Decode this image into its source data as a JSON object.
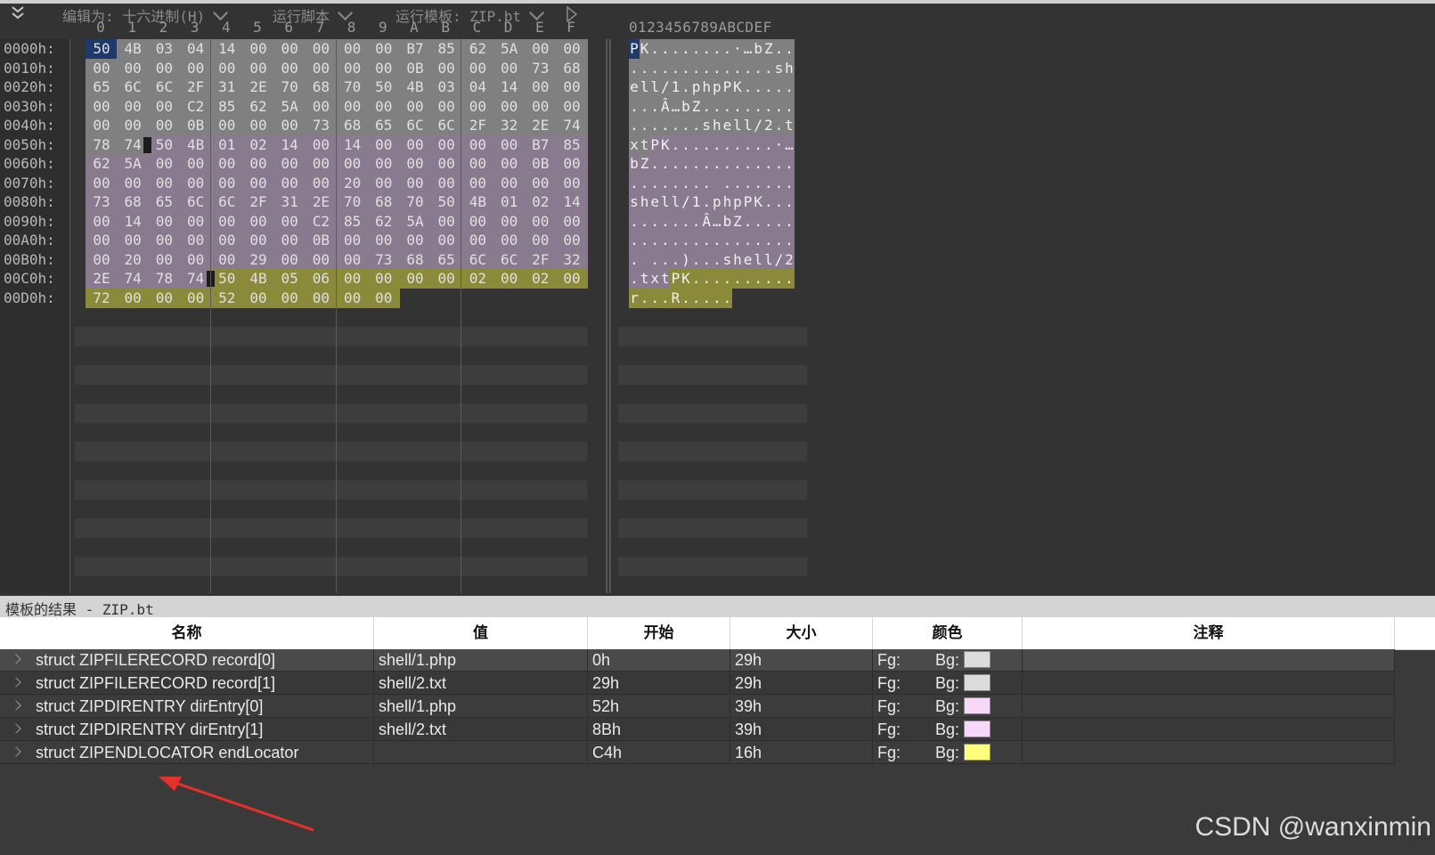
{
  "toolbar": {
    "edit_as": "编辑为: 十六进制(H)",
    "run_script": "运行脚本",
    "run_template": "运行模板: ZIP.bt"
  },
  "hex_view": {
    "column_headers": [
      "0",
      "1",
      "2",
      "3",
      "4",
      "5",
      "6",
      "7",
      "8",
      "9",
      "A",
      "B",
      "C",
      "D",
      "E",
      "F"
    ],
    "ascii_header": "0123456789ABCDEF",
    "rows": [
      {
        "offset": "0000h:",
        "bytes": [
          "50",
          "4B",
          "03",
          "04",
          "14",
          "00",
          "00",
          "00",
          "00",
          "00",
          "B7",
          "85",
          "62",
          "5A",
          "00",
          "00"
        ],
        "ascii": "PK........·…bZ.."
      },
      {
        "offset": "0010h:",
        "bytes": [
          "00",
          "00",
          "00",
          "00",
          "00",
          "00",
          "00",
          "00",
          "00",
          "00",
          "0B",
          "00",
          "00",
          "00",
          "73",
          "68"
        ],
        "ascii": "..............sh"
      },
      {
        "offset": "0020h:",
        "bytes": [
          "65",
          "6C",
          "6C",
          "2F",
          "31",
          "2E",
          "70",
          "68",
          "70",
          "50",
          "4B",
          "03",
          "04",
          "14",
          "00",
          "00"
        ],
        "ascii": "ell/1.phpPK....."
      },
      {
        "offset": "0030h:",
        "bytes": [
          "00",
          "00",
          "00",
          "C2",
          "85",
          "62",
          "5A",
          "00",
          "00",
          "00",
          "00",
          "00",
          "00",
          "00",
          "00",
          "00"
        ],
        "ascii": "...Â…bZ........."
      },
      {
        "offset": "0040h:",
        "bytes": [
          "00",
          "00",
          "00",
          "0B",
          "00",
          "00",
          "00",
          "73",
          "68",
          "65",
          "6C",
          "6C",
          "2F",
          "32",
          "2E",
          "74"
        ],
        "ascii": ".......shell/2.t"
      },
      {
        "offset": "0050h:",
        "bytes": [
          "78",
          "74",
          "50",
          "4B",
          "01",
          "02",
          "14",
          "00",
          "14",
          "00",
          "00",
          "00",
          "00",
          "00",
          "B7",
          "85"
        ],
        "ascii": "xtPK..........·…"
      },
      {
        "offset": "0060h:",
        "bytes": [
          "62",
          "5A",
          "00",
          "00",
          "00",
          "00",
          "00",
          "00",
          "00",
          "00",
          "00",
          "00",
          "00",
          "00",
          "0B",
          "00"
        ],
        "ascii": "bZ.............."
      },
      {
        "offset": "0070h:",
        "bytes": [
          "00",
          "00",
          "00",
          "00",
          "00",
          "00",
          "00",
          "00",
          "20",
          "00",
          "00",
          "00",
          "00",
          "00",
          "00",
          "00"
        ],
        "ascii": "........ ......."
      },
      {
        "offset": "0080h:",
        "bytes": [
          "73",
          "68",
          "65",
          "6C",
          "6C",
          "2F",
          "31",
          "2E",
          "70",
          "68",
          "70",
          "50",
          "4B",
          "01",
          "02",
          "14"
        ],
        "ascii": "shell/1.phpPK..."
      },
      {
        "offset": "0090h:",
        "bytes": [
          "00",
          "14",
          "00",
          "00",
          "00",
          "00",
          "00",
          "C2",
          "85",
          "62",
          "5A",
          "00",
          "00",
          "00",
          "00",
          "00"
        ],
        "ascii": ".......Â…bZ....."
      },
      {
        "offset": "00A0h:",
        "bytes": [
          "00",
          "00",
          "00",
          "00",
          "00",
          "00",
          "00",
          "0B",
          "00",
          "00",
          "00",
          "00",
          "00",
          "00",
          "00",
          "00"
        ],
        "ascii": "................"
      },
      {
        "offset": "00B0h:",
        "bytes": [
          "00",
          "20",
          "00",
          "00",
          "00",
          "29",
          "00",
          "00",
          "00",
          "73",
          "68",
          "65",
          "6C",
          "6C",
          "2F",
          "32"
        ],
        "ascii": ". ...)...shell/2"
      },
      {
        "offset": "00C0h:",
        "bytes": [
          "2E",
          "74",
          "78",
          "74",
          "50",
          "4B",
          "05",
          "06",
          "00",
          "00",
          "00",
          "00",
          "02",
          "00",
          "02",
          "00"
        ],
        "ascii": ".txtPK.........."
      },
      {
        "offset": "00D0h:",
        "bytes": [
          "72",
          "00",
          "00",
          "00",
          "52",
          "00",
          "00",
          "00",
          "00",
          "00"
        ],
        "ascii": "r...R....."
      }
    ],
    "region_colors": {
      "record": "#808080",
      "direntry": "#8a7a90",
      "endlocator": "#8a8a3a",
      "selection": "#1f3a6a"
    }
  },
  "results": {
    "title": "模板的结果 - ZIP.bt",
    "headers": [
      "名称",
      "值",
      "开始",
      "大小",
      "颜色",
      "注释"
    ],
    "rows": [
      {
        "name": "struct ZIPFILERECORD record[0]",
        "value": "shell/1.php",
        "start": "0h",
        "size": "29h",
        "fg": "Fg:",
        "bg": "Bg:",
        "bg_color": "#dcdcdc"
      },
      {
        "name": "struct ZIPFILERECORD record[1]",
        "value": "shell/2.txt",
        "start": "29h",
        "size": "29h",
        "fg": "Fg:",
        "bg": "Bg:",
        "bg_color": "#dcdcdc"
      },
      {
        "name": "struct ZIPDIRENTRY dirEntry[0]",
        "value": "shell/1.php",
        "start": "52h",
        "size": "39h",
        "fg": "Fg:",
        "bg": "Bg:",
        "bg_color": "#f8d8f8"
      },
      {
        "name": "struct ZIPDIRENTRY dirEntry[1]",
        "value": "shell/2.txt",
        "start": "8Bh",
        "size": "39h",
        "fg": "Fg:",
        "bg": "Bg:",
        "bg_color": "#f8d8f8"
      },
      {
        "name": "struct ZIPENDLOCATOR endLocator",
        "value": "",
        "start": "C4h",
        "size": "16h",
        "fg": "Fg:",
        "bg": "Bg:",
        "bg_color": "#ffff80"
      }
    ]
  },
  "watermark": "CSDN @wanxinmin"
}
